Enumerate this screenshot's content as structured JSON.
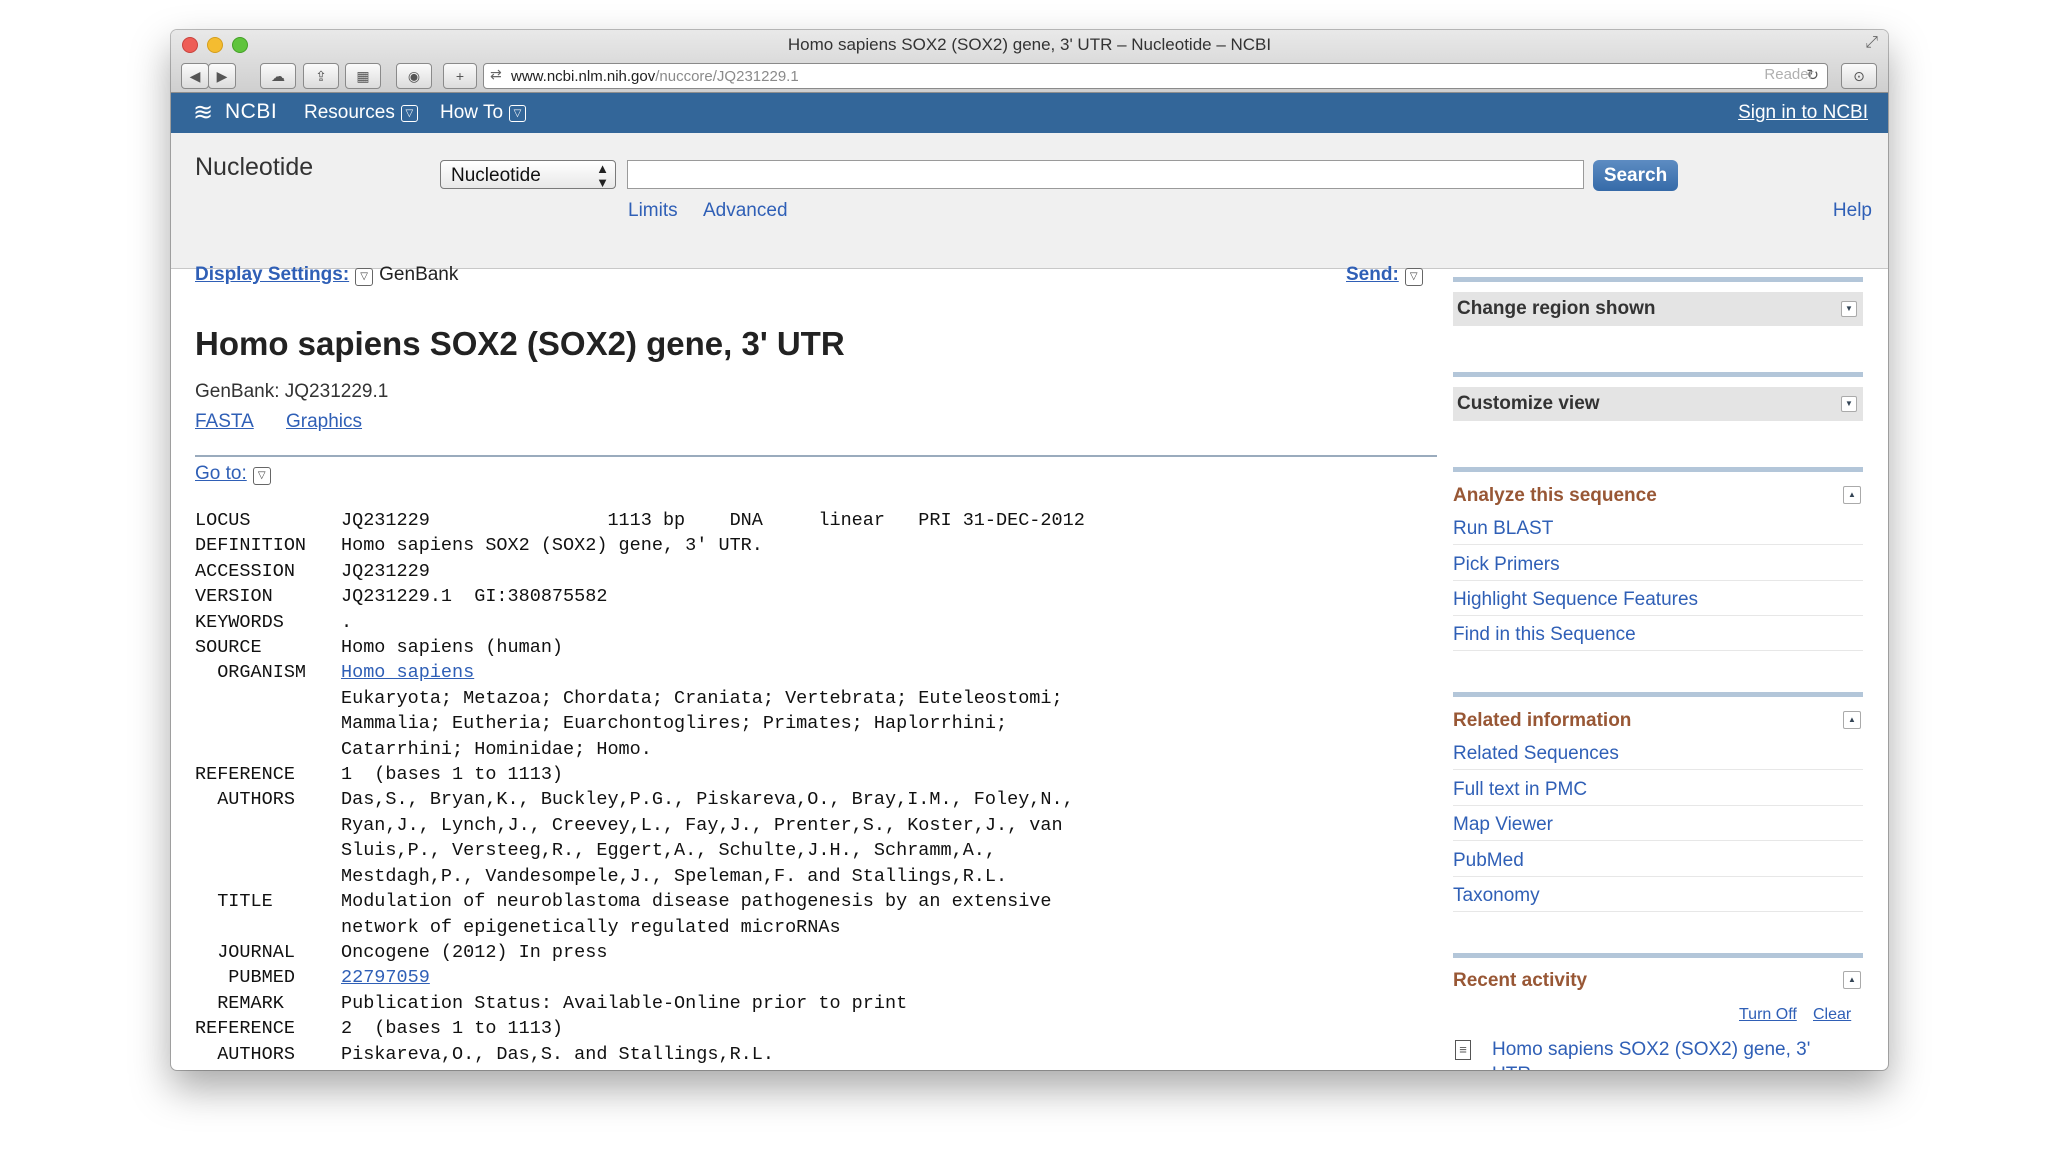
{
  "window": {
    "title": "Homo sapiens SOX2 (SOX2) gene, 3' UTR – Nucleotide – NCBI"
  },
  "toolbar": {
    "back_icon": "◀",
    "forward_icon": "▶",
    "cloud_icon": "☁",
    "share_icon": "⇪",
    "tabs_icon": "▦",
    "history_icon": "◉",
    "add_icon": "+",
    "url_domain": "www.ncbi.nlm.nih.gov",
    "url_path": "/nuccore/JQ231229.1",
    "reload_icon": "↻",
    "reader_label": "Reader",
    "download_icon": "⊙"
  },
  "header": {
    "logo_text": "NCBI",
    "menu_resources": "Resources",
    "menu_howto": "How To",
    "signin": "Sign in to NCBI"
  },
  "search": {
    "db_title": "Nucleotide",
    "db_selected": "Nucleotide",
    "query": "",
    "button": "Search",
    "limits": "Limits",
    "advanced": "Advanced",
    "help": "Help"
  },
  "content": {
    "display_settings_label": "Display Settings:",
    "display_format": "GenBank",
    "send_label": "Send:",
    "record_title": "Homo sapiens SOX2 (SOX2) gene, 3' UTR",
    "record_accession": "GenBank: JQ231229.1",
    "fasta_link": "FASTA",
    "graphics_link": "Graphics",
    "goto_label": "Go to:"
  },
  "genbank": {
    "locus_key": "LOCUS",
    "locus_val": "JQ231229                1113 bp    DNA     linear   PRI 31-DEC-2012",
    "definition_key": "DEFINITION",
    "definition_val": "Homo sapiens SOX2 (SOX2) gene, 3' UTR.",
    "accession_key": "ACCESSION",
    "accession_val": "JQ231229",
    "version_key": "VERSION",
    "version_val": "JQ231229.1  GI:380875582",
    "keywords_key": "KEYWORDS",
    "keywords_val": ".",
    "source_key": "SOURCE",
    "source_val": "Homo sapiens (human)",
    "organism_key": "  ORGANISM",
    "organism_link": "Homo sapiens",
    "lineage_1": "Eukaryota; Metazoa; Chordata; Craniata; Vertebrata; Euteleostomi;",
    "lineage_2": "Mammalia; Eutheria; Euarchontoglires; Primates; Haplorrhini;",
    "lineage_3": "Catarrhini; Hominidae; Homo.",
    "ref1_key": "REFERENCE",
    "ref1_val": "1  (bases 1 to 1113)",
    "authors1_key": "  AUTHORS",
    "authors1_1": "Das,S., Bryan,K., Buckley,P.G., Piskareva,O., Bray,I.M., Foley,N.,",
    "authors1_2": "Ryan,J., Lynch,J., Creevey,L., Fay,J., Prenter,S., Koster,J., van",
    "authors1_3": "Sluis,P., Versteeg,R., Eggert,A., Schulte,J.H., Schramm,A.,",
    "authors1_4": "Mestdagh,P., Vandesompele,J., Speleman,F. and Stallings,R.L.",
    "title1_key": "  TITLE",
    "title1_1": "Modulation of neuroblastoma disease pathogenesis by an extensive",
    "title1_2": "network of epigenetically regulated microRNAs",
    "journal1_key": "  JOURNAL",
    "journal1_val": "Oncogene (2012) In press",
    "pubmed1_key": "   PUBMED",
    "pubmed1_link": "22797059",
    "remark1_key": "  REMARK",
    "remark1_val": "Publication Status: Available-Online prior to print",
    "ref2_key": "REFERENCE",
    "ref2_val": "2  (bases 1 to 1113)",
    "authors2_key": "  AUTHORS",
    "authors2_1": "Piskareva,O., Das,S. and Stallings,R.L."
  },
  "sidebar": {
    "change_region": "Change region shown",
    "customize_view": "Customize view",
    "analyze_title": "Analyze this sequence",
    "analyze_items": [
      "Run BLAST",
      "Pick Primers",
      "Highlight Sequence Features",
      "Find in this Sequence"
    ],
    "related_title": "Related information",
    "related_items": [
      "Related Sequences",
      "Full text in PMC",
      "Map Viewer",
      "PubMed",
      "Taxonomy"
    ],
    "recent_title": "Recent activity",
    "turn_off": "Turn Off",
    "clear": "Clear",
    "activity_item": "Homo sapiens SOX2 (SOX2) gene, 3' UTR"
  }
}
